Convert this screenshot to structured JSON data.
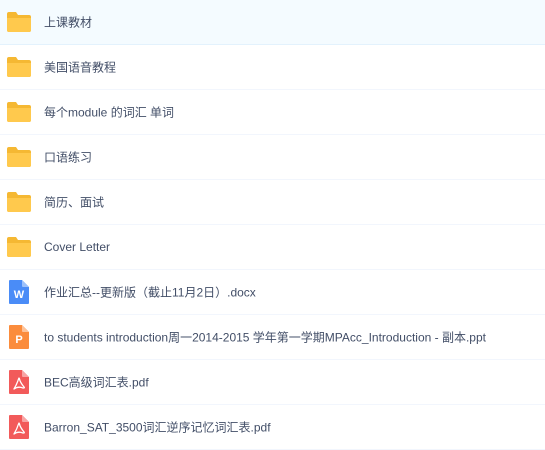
{
  "files": [
    {
      "name": "上课教材",
      "type": "folder",
      "icon": "folder-icon",
      "selected": true
    },
    {
      "name": "美国语音教程",
      "type": "folder",
      "icon": "folder-icon"
    },
    {
      "name": "每个module 的词汇 单词",
      "type": "folder",
      "icon": "folder-icon"
    },
    {
      "name": "口语练习",
      "type": "folder",
      "icon": "folder-icon"
    },
    {
      "name": "简历、面试",
      "type": "folder",
      "icon": "folder-icon"
    },
    {
      "name": "Cover Letter",
      "type": "folder",
      "icon": "folder-icon"
    },
    {
      "name": "作业汇总--更新版（截止11月2日）.docx",
      "type": "word",
      "icon": "word-doc-icon",
      "icon_letter": "W"
    },
    {
      "name": "to students introduction周一2014-2015 学年第一学期MPAcc_Introduction - 副本.ppt",
      "type": "ppt",
      "icon": "powerpoint-doc-icon",
      "icon_letter": "P"
    },
    {
      "name": "BEC高级词汇表.pdf",
      "type": "pdf",
      "icon": "pdf-doc-icon"
    },
    {
      "name": "Barron_SAT_3500词汇逆序记忆词汇表.pdf",
      "type": "pdf",
      "icon": "pdf-doc-icon"
    }
  ],
  "colors": {
    "folder": "#ffc94d",
    "folder_back": "#f5b833",
    "word": "#4a8cf7",
    "ppt": "#fb8c3c",
    "pdf": "#f25a5a",
    "text": "#424e67",
    "selected_bg": "#f4fbff"
  }
}
